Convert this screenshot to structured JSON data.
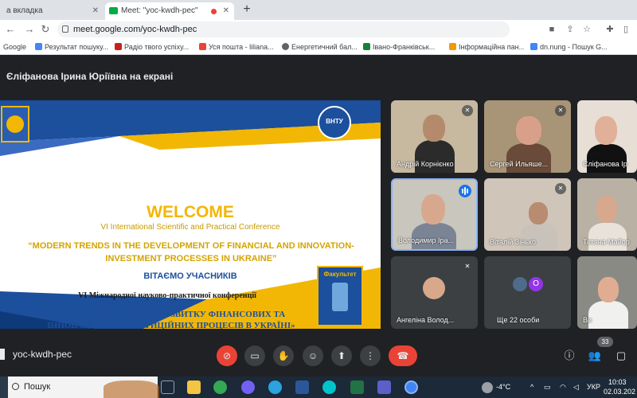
{
  "browser": {
    "tabs": [
      {
        "label": "а вкладка",
        "active": false
      },
      {
        "label": "Meet: \"yoc-kwdh-pec\"",
        "active": true
      }
    ],
    "url": "meet.google.com/yoc-kwdh-pec",
    "bookmarks": [
      {
        "label": "Google",
        "color": "#4285f4"
      },
      {
        "label": "Результат пошуку...",
        "color": "#4285f4"
      },
      {
        "label": "Радіо твого успіху...",
        "color": "#c5221f"
      },
      {
        "label": "Уся пошта - liliana...",
        "color": "#ea4335"
      },
      {
        "label": "Енергетичний бал...",
        "color": "#5f6368"
      },
      {
        "label": "Івано-Франківськ...",
        "color": "#188038"
      },
      {
        "label": "Інформаційна пан...",
        "color": "#f29900"
      },
      {
        "label": "dn.nung - Пошук G...",
        "color": "#4285f4"
      }
    ]
  },
  "meet": {
    "presenter_label": "Єліфанова Ірина Юріївна на екрані",
    "slide": {
      "logo_right": "ВНТУ",
      "welcome": "WELCOME",
      "subtitle_en": "VI International Scientific and Practical Conference",
      "title_en": "“MODERN TRENDS IN THE DEVELOPMENT OF FINANCIAL AND INNOVATION-INVESTMENT PROCESSES IN UKRAINE”",
      "welcome_ua": "ВІТАЄМО УЧАСНИКІВ",
      "conf_ua": "VI Міжнародної науково-практичної конференції",
      "title_ua": "«СУЧАСНІ ТЕНДЕНЦІЇ РОЗВИТКУ ФІНАНСОВИХ ТА ІННОВАЦІЙНО-ІНВЕСТИЦІЙНИХ ПРОЦЕСІВ В УКРАЇНІ»",
      "faculty_badge": "Факультет"
    },
    "participants": [
      {
        "name": "Андрій Корнієнко",
        "muted": true
      },
      {
        "name": "Сергей Ильяше...",
        "muted": true
      },
      {
        "name": "Єліфанова Ір",
        "muted": false
      },
      {
        "name": "Володимир Іра...",
        "speaking": true
      },
      {
        "name": "Віталій Зінько",
        "muted": true
      },
      {
        "name": "Тетяна Майор",
        "muted": false
      },
      {
        "name": "Ангеліна Волод...",
        "muted": true
      },
      {
        "name": "Ще 22 особи",
        "avatar_letter": "O"
      },
      {
        "name": "Ви",
        "muted": false
      }
    ],
    "meeting_code": "yoc-kwdh-pec",
    "people_count": "33"
  },
  "taskbar": {
    "search_placeholder": "Пошук",
    "weather": "-4°C",
    "language": "УКР",
    "time": "10:03",
    "date": "02.03.202"
  }
}
